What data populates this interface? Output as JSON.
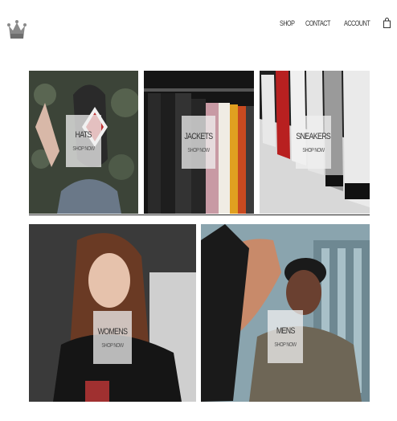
{
  "header": {
    "logo_icon": "crown-icon",
    "nav": [
      {
        "label": "SHOP"
      },
      {
        "label": "CONTACT"
      },
      {
        "label": "ACCOUNT"
      }
    ],
    "cart_icon": "shopping-bag-icon"
  },
  "categories": [
    {
      "title": "HATS",
      "cta": "SHOP NOW"
    },
    {
      "title": "JACKETS",
      "cta": "SHOP NOW"
    },
    {
      "title": "SNEAKERS",
      "cta": "SHOP NOW"
    },
    {
      "title": "WOMENS",
      "cta": "SHOP NOW"
    },
    {
      "title": "MENS",
      "cta": "SHOP NOW"
    }
  ]
}
